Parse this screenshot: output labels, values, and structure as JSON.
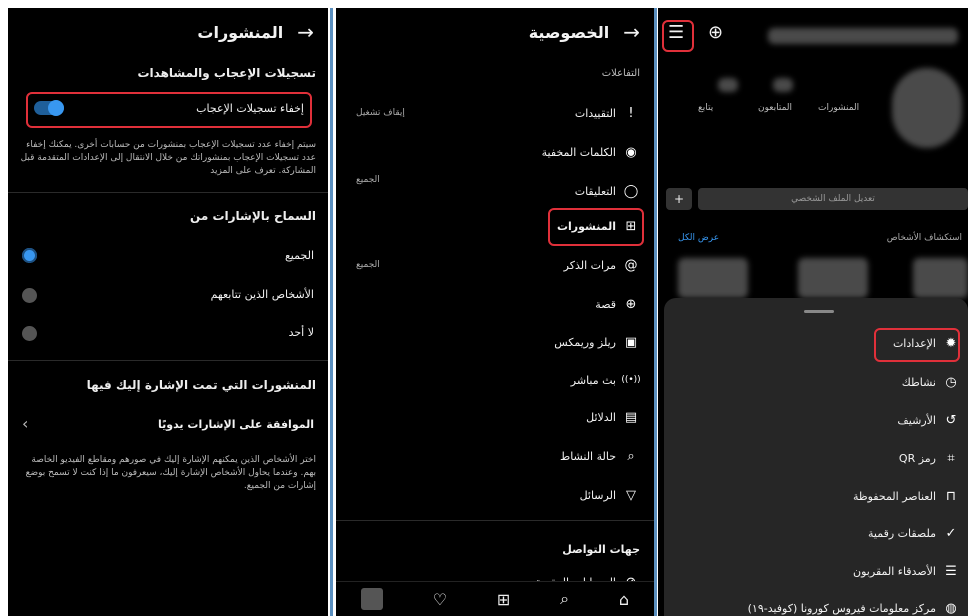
{
  "panel_posts": {
    "title": "المنشورات",
    "back_arrow": "→",
    "section_likes": "تسجيلات الإعجاب والمشاهدات",
    "hide_likes_label": "إخفاء تسجيلات الإعجاب",
    "hide_likes_desc": "سيتم إخفاء عدد تسجيلات الإعجاب بمنشورات من حسابات أخرى. يمكنك إخفاء عدد تسجيلات الإعجاب بمنشوراتك من خلال الانتقال إلى الإعدادات المتقدمة قبل المشاركة. تعرف على المزيد",
    "section_tags": "السماح بالإشارات من",
    "tag_options": [
      "الجميع",
      "الأشخاص الذين تتابعهم",
      "لا أحد"
    ],
    "section_tagged_posts": "المنشورات التي تمت الإشارة إليك فيها",
    "manual_approve": "الموافقة على الإشارات يدويًا",
    "manual_desc": "اختر الأشخاص الذين يمكنهم الإشارة إليك في صورهم ومقاطع الفيديو الخاصة بهم. وعندما يحاول الأشخاص الإشارة إليك، سيعرفون ما إذا كنت لا تسمح بوضع إشارات من الجميع.",
    "chevron": "‹",
    "accent": "#3897f0"
  },
  "panel_privacy": {
    "title": "الخصوصية",
    "back_arrow": "→",
    "section_interactions": "التفاعلات",
    "items": [
      {
        "label": "التقييدات",
        "icon": "!",
        "value": "إيقاف تشغيل"
      },
      {
        "label": "الكلمات المخفية",
        "icon": "◉",
        "value": ""
      },
      {
        "label": "التعليقات",
        "icon": "◯",
        "value": "الجميع"
      },
      {
        "label": "المنشورات",
        "icon": "⊞",
        "value": ""
      },
      {
        "label": "مرات الذكر",
        "icon": "@",
        "value": "الجميع"
      },
      {
        "label": "قصة",
        "icon": "⊕",
        "value": ""
      },
      {
        "label": "ريلز وريمكس",
        "icon": "▣",
        "value": ""
      },
      {
        "label": "بث مباشر",
        "icon": "((•))",
        "value": ""
      },
      {
        "label": "الدلائل",
        "icon": "▤",
        "value": ""
      },
      {
        "label": "حالة النشاط",
        "icon": "⌕",
        "value": ""
      },
      {
        "label": "الرسائل",
        "icon": "▽",
        "value": ""
      }
    ],
    "section_connections": "جهات التواصل",
    "restricted_accounts": "الحسابات المقيدة",
    "nav_icons": [
      "⌂",
      "⌕",
      "⊞",
      "♡",
      ""
    ]
  },
  "panel_profile": {
    "menu_icon": "☰",
    "add_icon": "⊕",
    "stats_labels": [
      "المنشورات",
      "المتابعون",
      "يتابع"
    ],
    "edit_profile": "تعديل الملف الشخصي",
    "discover_people": "استكشاف الأشخاص",
    "see_all": "عرض الكل",
    "sheet_items": [
      {
        "label": "الإعدادات",
        "icon": "✹"
      },
      {
        "label": "نشاطك",
        "icon": "◷"
      },
      {
        "label": "الأرشيف",
        "icon": "↺"
      },
      {
        "label": "رمز QR",
        "icon": "⌗"
      },
      {
        "label": "العناصر المحفوظة",
        "icon": "⊓"
      },
      {
        "label": "ملصقات رقمية",
        "icon": "✓"
      },
      {
        "label": "الأصدقاء المقربون",
        "icon": "☰"
      },
      {
        "label": "مركز معلومات فيروس كورونا (كوفيد-١٩)",
        "icon": "◍"
      }
    ]
  },
  "colors": {
    "highlight": "#e0303a",
    "divider": "#5a8fbf",
    "panel_bg": "#000000",
    "sheet_bg": "#262626"
  }
}
